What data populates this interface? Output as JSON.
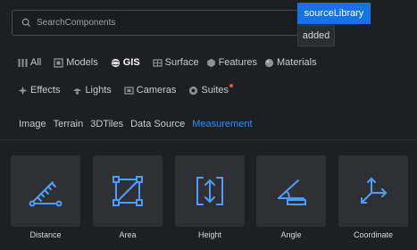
{
  "search": {
    "placeholder": "SearchComponents"
  },
  "tooltips": {
    "primary": "sourceLibrary",
    "secondary": "added"
  },
  "categories_row1": [
    {
      "label": "All",
      "icon": "grid-icon",
      "active": false
    },
    {
      "label": "Models",
      "icon": "models-icon",
      "active": false
    },
    {
      "label": "GIS",
      "icon": "globe-icon",
      "active": true
    },
    {
      "label": "Surface",
      "icon": "surface-icon",
      "active": false
    },
    {
      "label": "Features",
      "icon": "features-icon",
      "active": false
    },
    {
      "label": "Materials",
      "icon": "materials-icon",
      "active": false
    }
  ],
  "categories_row2": [
    {
      "label": "Effects",
      "icon": "sparkle-icon",
      "active": false
    },
    {
      "label": "Lights",
      "icon": "lights-icon",
      "active": false
    },
    {
      "label": "Cameras",
      "icon": "camera-icon",
      "active": false
    },
    {
      "label": "Suites",
      "icon": "suites-icon",
      "active": false,
      "badge": true
    }
  ],
  "subtabs": [
    {
      "label": "Image",
      "active": false
    },
    {
      "label": "Terrain",
      "active": false
    },
    {
      "label": "3DTiles",
      "active": false
    },
    {
      "label": "Data Source",
      "active": false
    },
    {
      "label": "Measurement",
      "active": true
    }
  ],
  "components": [
    {
      "label": "Distance",
      "icon": "distance-ruler-icon"
    },
    {
      "label": "Area",
      "icon": "area-square-icon"
    },
    {
      "label": "Height",
      "icon": "height-arrow-icon"
    },
    {
      "label": "Angle",
      "icon": "angle-icon"
    },
    {
      "label": "Coordinate",
      "icon": "coordinate-axes-icon"
    }
  ],
  "colors": {
    "accent": "#1473e6",
    "active_tab": "#2f8cff",
    "badge": "#e8562c",
    "card_bg": "#2e3034",
    "icon": "#4f9cff"
  }
}
